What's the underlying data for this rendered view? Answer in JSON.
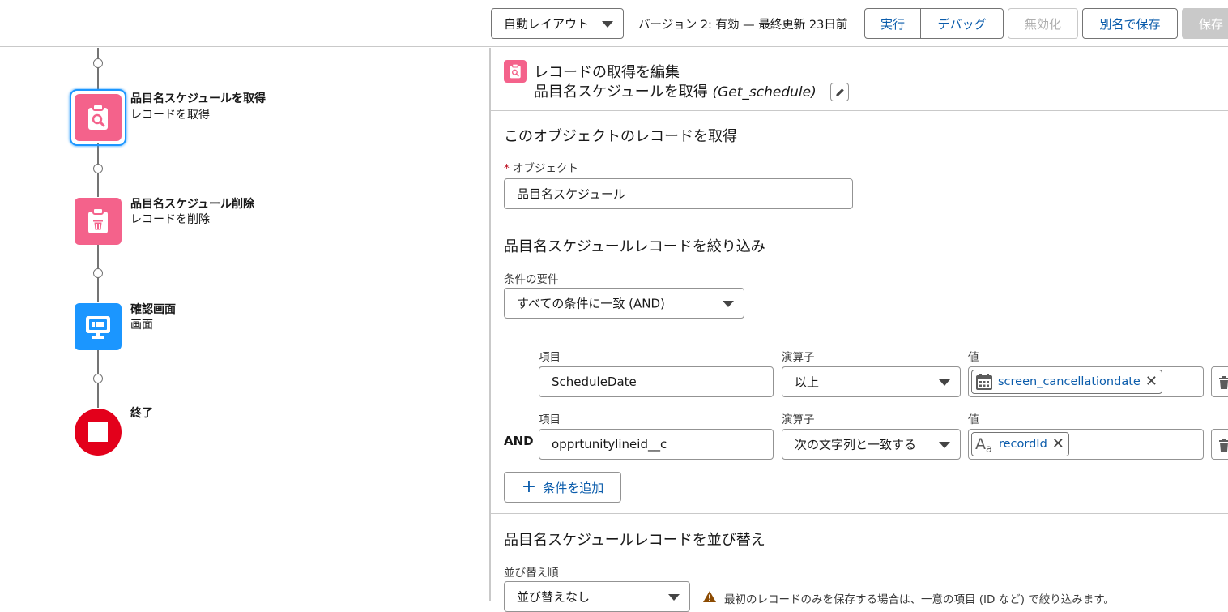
{
  "toolbar": {
    "layout_select": "自動レイアウト",
    "version_info": "バージョン 2: 有効 — 最終更新 23日前",
    "run": "実行",
    "debug": "デバッグ",
    "deactivate": "無効化",
    "save_as": "別名で保存",
    "save": "保存"
  },
  "flow": {
    "nodes": [
      {
        "title": "品目名スケジュールを取得",
        "subtitle": "レコードを取得",
        "color": "#f4628b",
        "icon": "get-records-icon"
      },
      {
        "title": "品目名スケジュール削除",
        "subtitle": "レコードを削除",
        "color": "#f4628b",
        "icon": "delete-records-icon"
      },
      {
        "title": "確認画面",
        "subtitle": "画面",
        "color": "#1b96ff",
        "icon": "screen-icon"
      },
      {
        "title": "終了",
        "subtitle": "",
        "color": "#e3001b",
        "icon": "end-icon"
      }
    ]
  },
  "panel": {
    "header_title": "レコードの取得を編集",
    "header_subtitle": "品目名スケジュールを取得",
    "header_api": "(Get_schedule)",
    "object_section": "このオブジェクトのレコードを取得",
    "object_required": "*",
    "object_label": "オブジェクト",
    "object_value": "品目名スケジュール",
    "filter_section": "品目名スケジュールレコードを絞り込み",
    "condition_req_label": "条件の要件",
    "condition_req_value": "すべての条件に一致 (AND)",
    "conditions": [
      {
        "logic": "",
        "field_label": "項目",
        "operator_label": "演算子",
        "value_label": "値",
        "field": "ScheduleDate",
        "operator": "以上",
        "value": "screen_cancellationdate",
        "value_icon": "calendar-icon"
      },
      {
        "logic": "AND",
        "field_label": "項目",
        "operator_label": "演算子",
        "value_label": "値",
        "field": "opprtunitylineid__c",
        "operator": "次の文字列と一致する",
        "value": "recordId",
        "value_icon": "text-icon"
      }
    ],
    "add_condition": "条件を追加",
    "sort_section": "品目名スケジュールレコードを並び替え",
    "sort_order_label": "並び替え順",
    "sort_order_value": "並び替えなし",
    "warning_text": "最初のレコードのみを保存する場合は、一意の項目 (ID など) で絞り込みます。"
  }
}
